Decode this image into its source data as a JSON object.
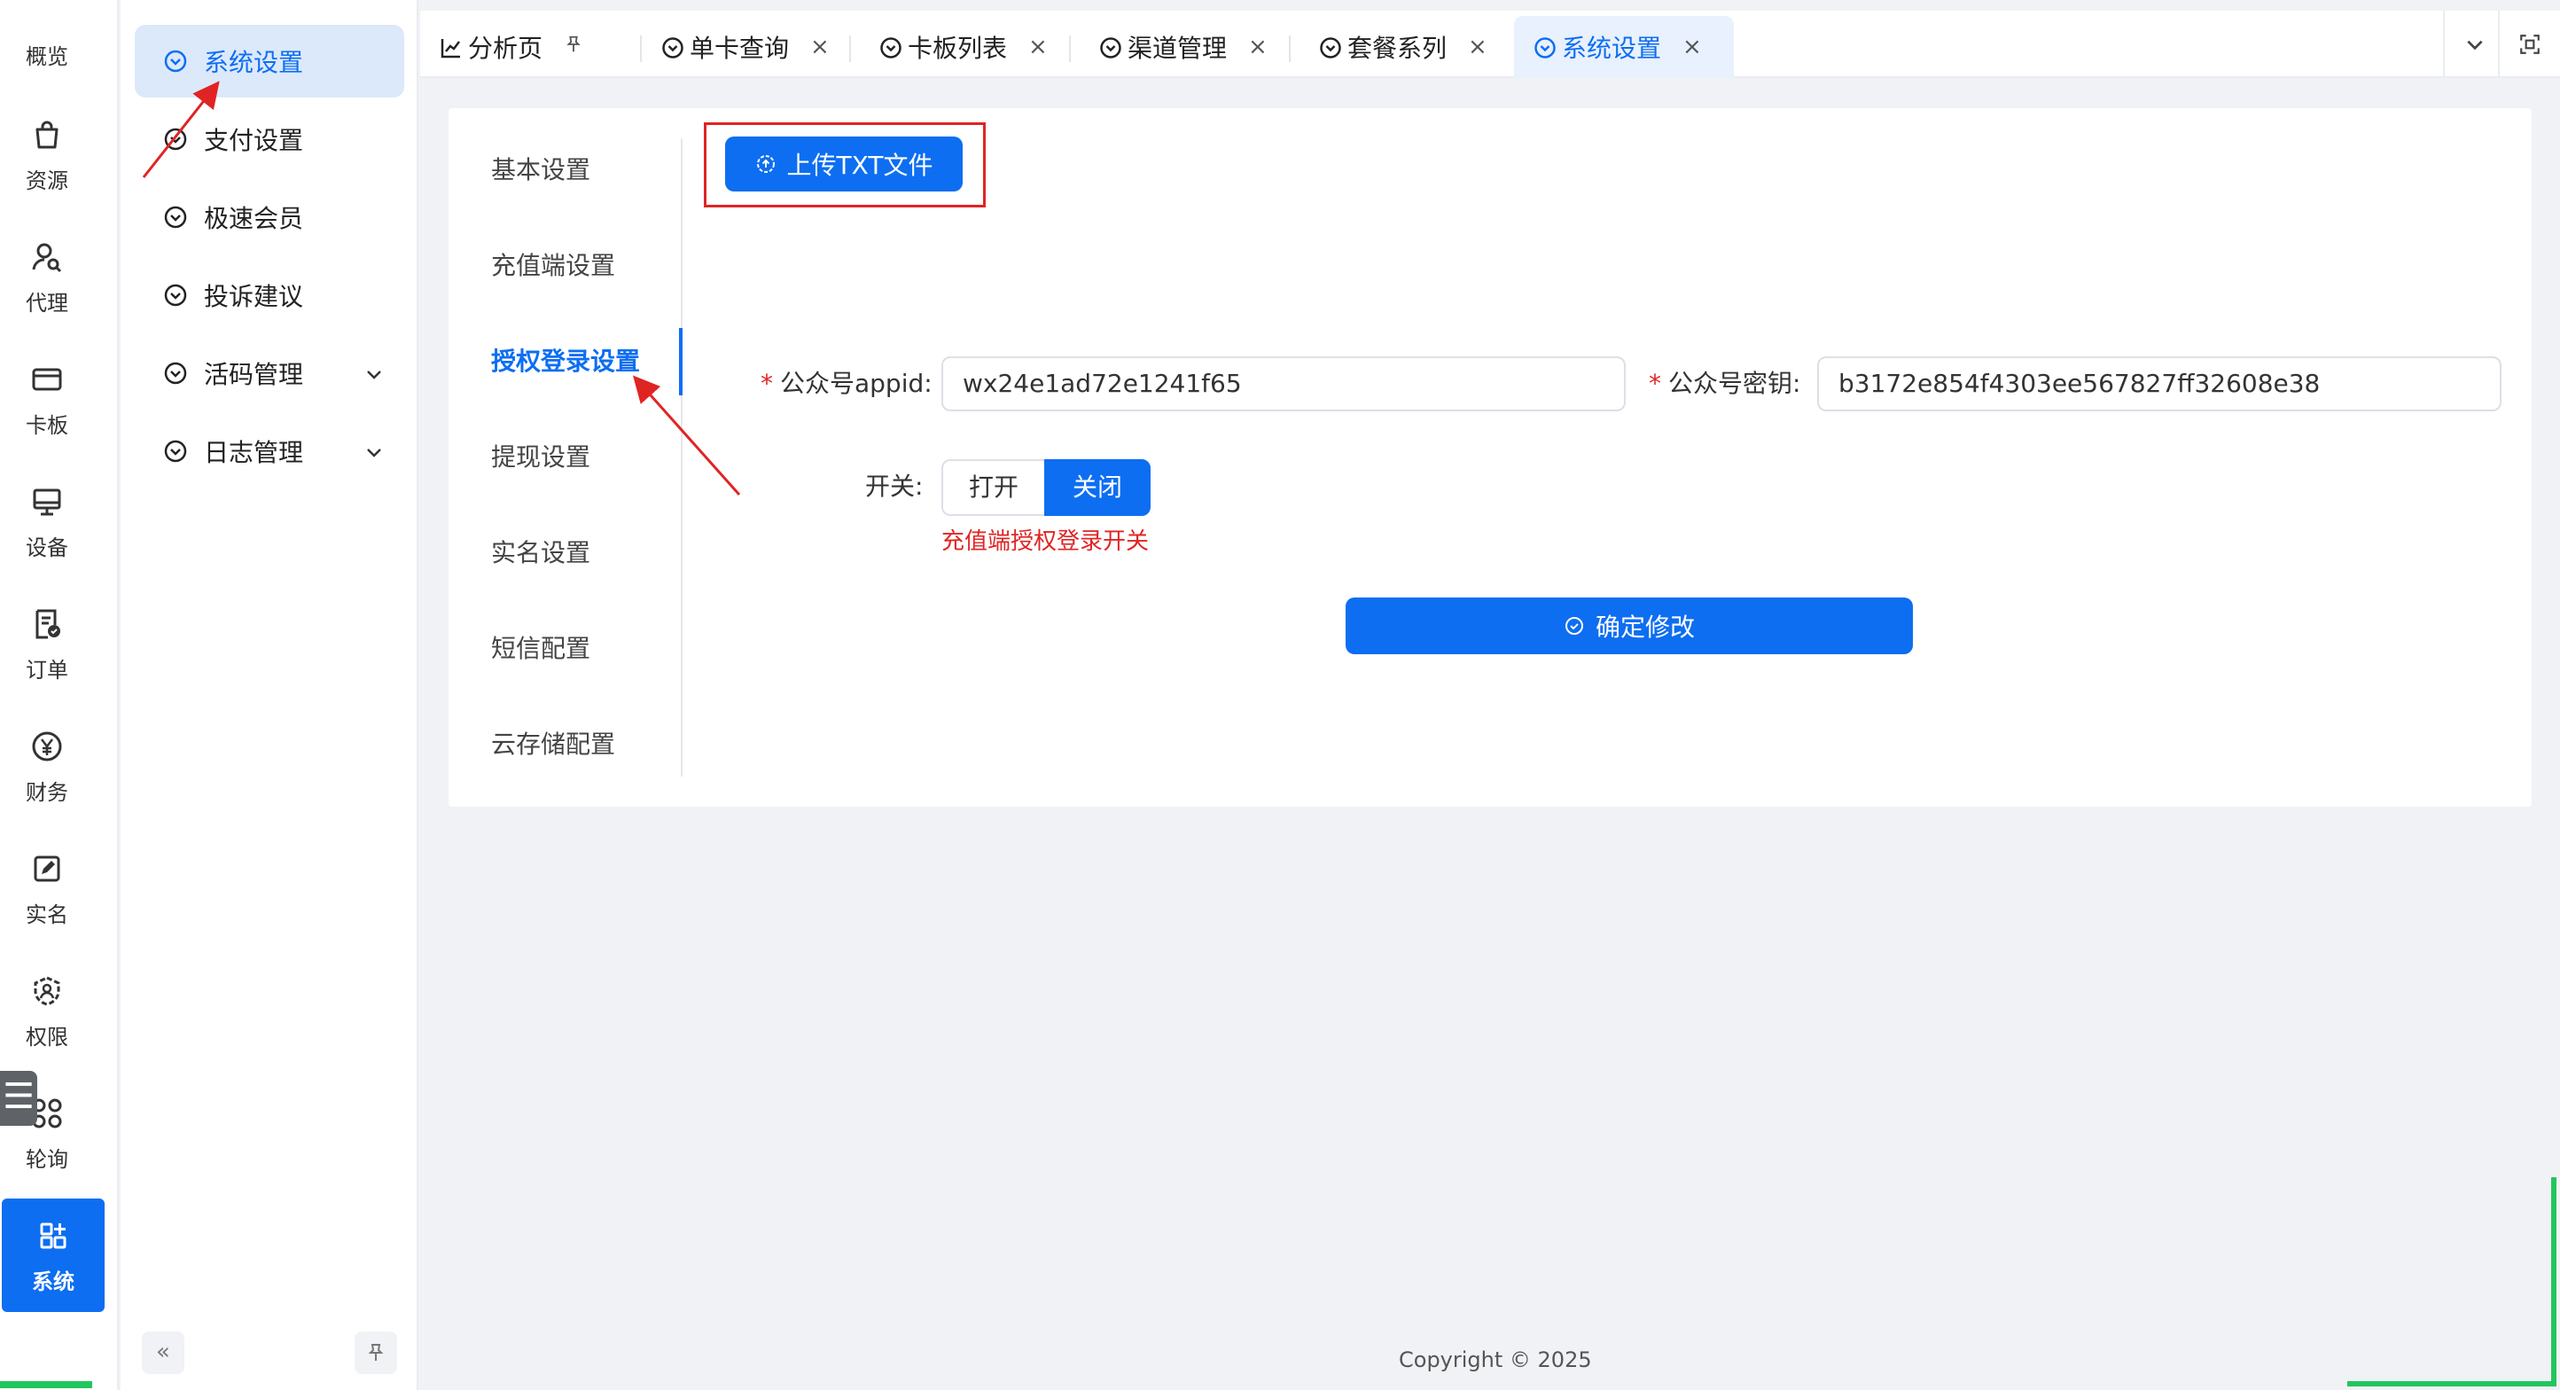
{
  "rail": {
    "items": [
      {
        "label": "概览",
        "icon": "overview-icon"
      },
      {
        "label": "资源",
        "icon": "shopping-bag-icon"
      },
      {
        "label": "代理",
        "icon": "agent-user-icon"
      },
      {
        "label": "卡板",
        "icon": "card-icon"
      },
      {
        "label": "设备",
        "icon": "monitor-icon"
      },
      {
        "label": "订单",
        "icon": "order-icon"
      },
      {
        "label": "财务",
        "icon": "yen-icon"
      },
      {
        "label": "实名",
        "icon": "edit-square-icon"
      },
      {
        "label": "权限",
        "icon": "permission-icon"
      },
      {
        "label": "轮询",
        "icon": "poll-nodes-icon"
      },
      {
        "label": "系统",
        "icon": "grid-apps-icon"
      }
    ],
    "active_index": 10,
    "handle_glyph": "☰"
  },
  "menu": {
    "items": [
      {
        "label": "系统设置",
        "icon": "circle-chevron-icon",
        "expandable": false
      },
      {
        "label": "支付设置",
        "icon": "circle-chevron-icon",
        "expandable": false
      },
      {
        "label": "极速会员",
        "icon": "circle-chevron-icon",
        "expandable": false
      },
      {
        "label": "投诉建议",
        "icon": "circle-chevron-icon",
        "expandable": false
      },
      {
        "label": "活码管理",
        "icon": "circle-chevron-icon",
        "expandable": true
      },
      {
        "label": "日志管理",
        "icon": "circle-chevron-icon",
        "expandable": true
      }
    ],
    "active_index": 0,
    "collapse_glyph": "«",
    "pin_glyph": "⚲"
  },
  "tabs": [
    {
      "label": "分析页",
      "icon": "chart-icon",
      "closable": false,
      "pinned": true
    },
    {
      "label": "单卡查询",
      "icon": "circle-chevron-icon",
      "closable": true
    },
    {
      "label": "卡板列表",
      "icon": "circle-chevron-icon",
      "closable": true
    },
    {
      "label": "渠道管理",
      "icon": "circle-chevron-icon",
      "closable": true
    },
    {
      "label": "套餐系列",
      "icon": "circle-chevron-icon",
      "closable": true
    },
    {
      "label": "系统设置",
      "icon": "circle-chevron-icon",
      "closable": true,
      "active": true
    }
  ],
  "tab_close_glyph": "×",
  "subnav": {
    "items": [
      "基本设置",
      "充值端设置",
      "授权登录设置",
      "提现设置",
      "实名设置",
      "短信配置",
      "云存储配置"
    ],
    "active_index": 2
  },
  "form": {
    "upload_label": "上传TXT文件",
    "appid_label": "公众号appid",
    "appid_value": "wx24e1ad72e1241f65",
    "secret_label": "公众号密钥",
    "secret_value": "b3172e854f4303ee567827ff32608e38",
    "colon": ":",
    "required_mark": "*",
    "switch_label": "开关:",
    "switch_on": "打开",
    "switch_off": "关闭",
    "switch_selected": "关闭",
    "switch_hint": "充值端授权登录开关",
    "confirm_label": "确定修改"
  },
  "footer": {
    "copyright": "Copyright © 2025"
  },
  "colors": {
    "primary": "#0d6ef2",
    "active_menu_bg": "#dce9fb",
    "annotation_red": "#e02424",
    "accent_green": "#22c55e",
    "page_bg": "#f0f2f5"
  }
}
